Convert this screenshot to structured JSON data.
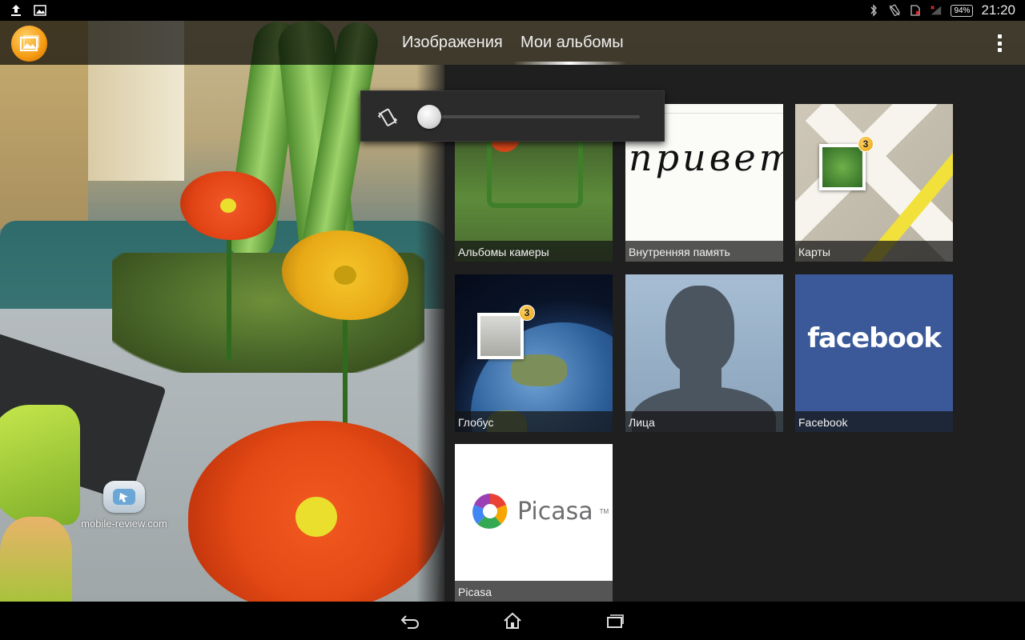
{
  "status_bar": {
    "left_icons": [
      "upload-icon",
      "image-icon"
    ],
    "right_icons": [
      "bluetooth-icon",
      "vibrate-icon",
      "sim-icon",
      "signal-icon"
    ],
    "battery": "94%",
    "time": "21:20"
  },
  "action_bar": {
    "app_icon": "gallery-app-icon",
    "tabs": [
      {
        "label": "Изображения",
        "selected": false
      },
      {
        "label": "Мои альбомы",
        "selected": true
      }
    ],
    "overflow_icon": "overflow-menu-icon"
  },
  "volume_popup": {
    "icon": "vibrate-icon",
    "level": 0.0
  },
  "albums": [
    {
      "label": "Альбомы камеры"
    },
    {
      "label": "Внутренняя память",
      "thumbnail_text": "привет"
    },
    {
      "label": "Карты",
      "badge": "3"
    },
    {
      "label": "Глобус",
      "badge": "3"
    },
    {
      "label": "Лица"
    },
    {
      "label": "Facebook",
      "logo_text": "facebook"
    },
    {
      "label": "Picasa",
      "logo_text": "Picasa",
      "logo_tm": "TM"
    }
  ],
  "watermark": {
    "text": "mobile-review.com"
  },
  "nav_bar": {
    "buttons": [
      "back-icon",
      "home-icon",
      "recents-icon"
    ]
  }
}
